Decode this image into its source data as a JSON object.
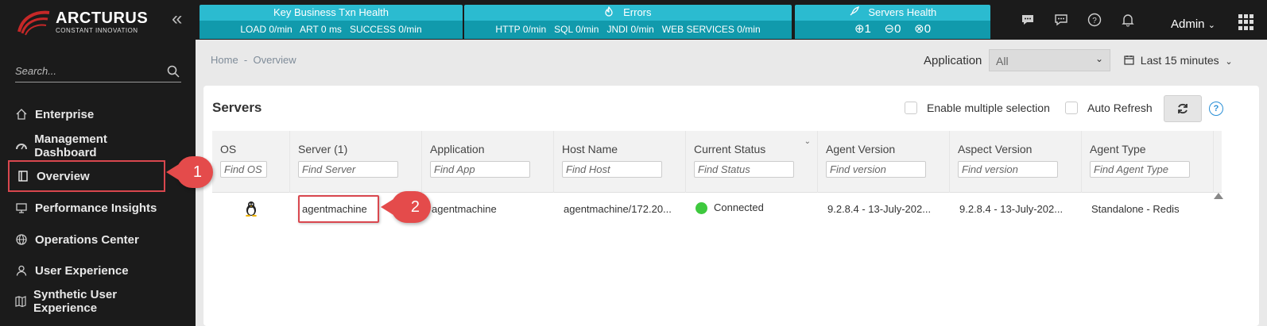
{
  "brand": {
    "name": "ARCTURUS",
    "tagline": "CONSTANT INNOVATION"
  },
  "health": {
    "txn": {
      "title": "Key Business Txn Health",
      "load": "LOAD 0/min",
      "art": "ART 0 ms",
      "success": "SUCCESS 0/min"
    },
    "errors": {
      "title": "Errors",
      "http": "HTTP 0/min",
      "sql": "SQL 0/min",
      "jndi": "JNDI 0/min",
      "ws": "WEB SERVICES 0/min"
    },
    "servers": {
      "title": "Servers Health",
      "up": "1",
      "right": "0",
      "down": "0"
    }
  },
  "header": {
    "user": "Admin"
  },
  "sidebar": {
    "search_placeholder": "Search...",
    "items": [
      {
        "label": "Enterprise",
        "icon": "home-icon"
      },
      {
        "label": "Management Dashboard",
        "icon": "dashboard-icon"
      },
      {
        "label": "Overview",
        "icon": "book-icon"
      },
      {
        "label": "Performance Insights",
        "icon": "monitor-icon"
      },
      {
        "label": "Operations Center",
        "icon": "globe-icon"
      },
      {
        "label": "User Experience",
        "icon": "user-icon"
      },
      {
        "label": "Synthetic User Experience",
        "icon": "map-icon"
      }
    ]
  },
  "breadcrumb": {
    "home": "Home",
    "sep": "-",
    "current": "Overview"
  },
  "filters": {
    "application_label": "Application",
    "application_value": "All",
    "time_range": "Last 15 minutes"
  },
  "panel": {
    "title": "Servers",
    "multi_select": "Enable multiple selection",
    "auto_refresh": "Auto Refresh"
  },
  "table": {
    "columns": [
      {
        "label": "OS",
        "placeholder": "Find OS"
      },
      {
        "label": "Server (1)",
        "placeholder": "Find Server"
      },
      {
        "label": "Application",
        "placeholder": "Find App"
      },
      {
        "label": "Host Name",
        "placeholder": "Find Host"
      },
      {
        "label": "Current Status",
        "placeholder": "Find Status"
      },
      {
        "label": "Agent Version",
        "placeholder": "Find version"
      },
      {
        "label": "Aspect Version",
        "placeholder": "Find version"
      },
      {
        "label": "Agent Type",
        "placeholder": "Find Agent Type"
      }
    ],
    "rows": [
      {
        "os": "linux",
        "server": "agentmachine",
        "application": "agentmachine",
        "host": "agentmachine/172.20...",
        "status": "Connected",
        "agent_version": "9.2.8.4 - 13-July-202...",
        "aspect_version": "9.2.8.4 - 13-July-202...",
        "agent_type": "Standalone - Redis"
      }
    ]
  },
  "callouts": {
    "one": "1",
    "two": "2"
  },
  "colors": {
    "accent": "#2bbbd0",
    "accent_dark": "#119aac",
    "highlight": "#d9474e",
    "status_ok": "#3ec93e"
  }
}
